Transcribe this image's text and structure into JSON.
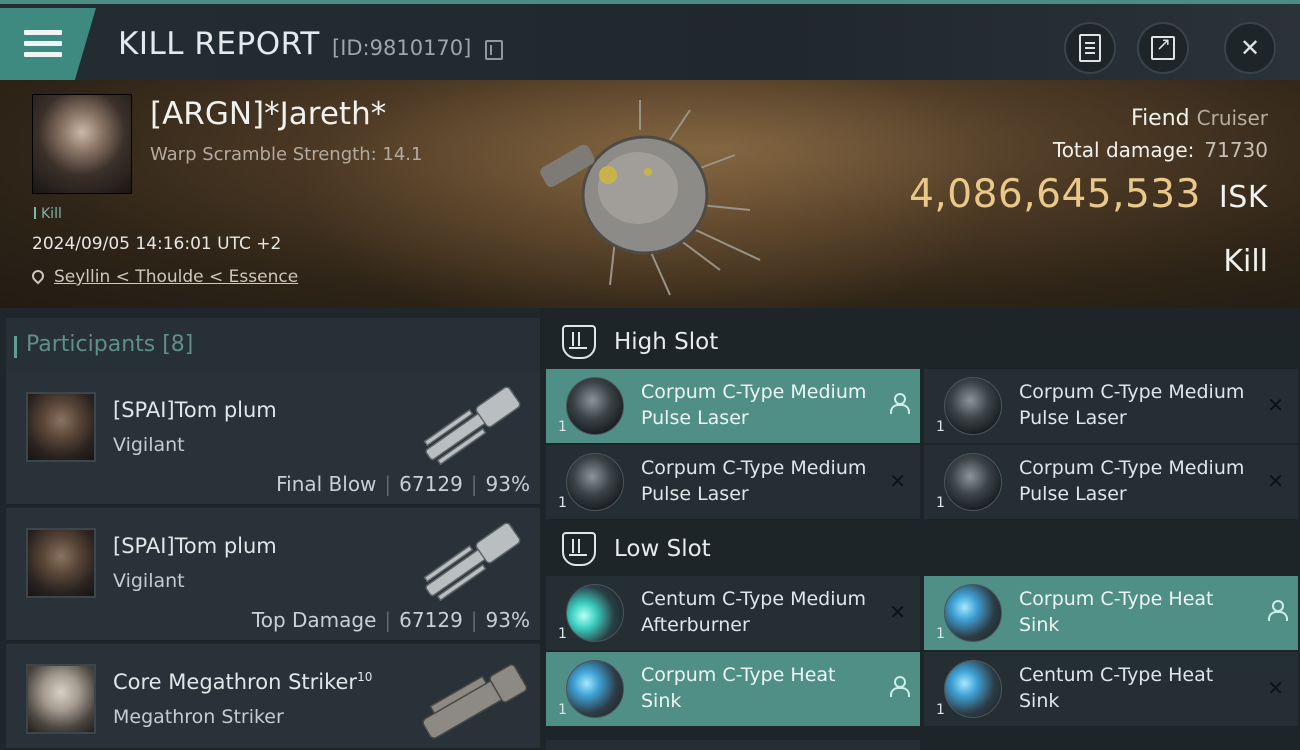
{
  "header": {
    "title": "KILL REPORT",
    "id_label": "[ID:9810170]"
  },
  "victim": {
    "name": "[ARGN]*Jareth*",
    "warp_scramble": "Warp Scramble Strength: 14.1",
    "tag": "Kill",
    "date": "2024/09/05 14:16:01 UTC +2",
    "location": "Seyllin < Thoulde < Essence",
    "ship": "Fiend",
    "ship_class": "Cruiser",
    "total_damage_label": "Total damage:",
    "total_damage_value": "71730",
    "isk_value": "4,086,645,533",
    "isk_currency": "ISK",
    "result": "Kill"
  },
  "participants": {
    "label": "Participants [8]",
    "rows": [
      {
        "name": "[SPAI]Tom plum",
        "ship": "Vigilant",
        "role": "Final Blow",
        "damage": "67129",
        "percent": "93%"
      },
      {
        "name": "[SPAI]Tom plum",
        "ship": "Vigilant",
        "role": "Top Damage",
        "damage": "67129",
        "percent": "93%"
      },
      {
        "name": "Core Megathron Striker",
        "level": "10",
        "ship": "Megathron Striker"
      }
    ]
  },
  "fitting": {
    "high_slot_label": "High Slot",
    "low_slot_label": "Low Slot",
    "high": [
      {
        "name": "Corpum C-Type Medium Pulse Laser",
        "qty": "1",
        "state": "destroyed-by-player"
      },
      {
        "name": "Corpum C-Type Medium Pulse Laser",
        "qty": "1",
        "state": "destroyed"
      },
      {
        "name": "Corpum C-Type Medium Pulse Laser",
        "qty": "1",
        "state": "destroyed"
      },
      {
        "name": "Corpum C-Type Medium Pulse Laser",
        "qty": "1",
        "state": "destroyed"
      }
    ],
    "low": [
      {
        "name": "Centum C-Type Medium Afterburner",
        "qty": "1",
        "state": "destroyed"
      },
      {
        "name": "Corpum C-Type Heat Sink",
        "qty": "1",
        "state": "dropped"
      },
      {
        "name": "Corpum C-Type Heat Sink",
        "qty": "1",
        "state": "dropped"
      },
      {
        "name": "Centum C-Type Heat Sink",
        "qty": "1",
        "state": "destroyed"
      }
    ],
    "colors": {
      "highlight": "#4f8f86",
      "isk": "#e9c98a"
    }
  }
}
